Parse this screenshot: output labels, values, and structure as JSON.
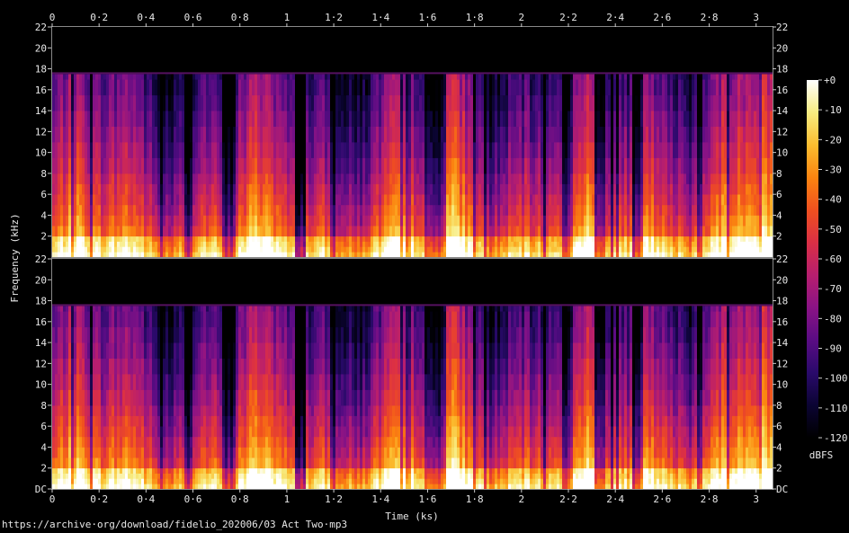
{
  "chart_data": {
    "type": "heatmap",
    "subtype": "spectrogram",
    "channels": 2,
    "xlabel": "Time (ks)",
    "ylabel": "Frequency (kHz)",
    "x_ticks": [
      "0",
      "0·2",
      "0·4",
      "0·6",
      "0·8",
      "1",
      "1·2",
      "1·4",
      "1·6",
      "1·8",
      "2",
      "2·2",
      "2·4",
      "2·6",
      "2·8",
      "3"
    ],
    "x_range": [
      0,
      3.07
    ],
    "y_ticks_top": [
      "22",
      "20",
      "18",
      "16",
      "14",
      "12",
      "10",
      "8",
      "6",
      "4",
      "2"
    ],
    "y_ticks_bottom": [
      "22",
      "20",
      "18",
      "16",
      "14",
      "12",
      "10",
      "8",
      "6",
      "4",
      "2",
      "DC"
    ],
    "y_range": [
      0,
      22
    ],
    "colorbar": {
      "label": "dBFS",
      "ticks": [
        "+0",
        "-10",
        "-20",
        "-30",
        "-40",
        "-50",
        "-60",
        "-70",
        "-80",
        "-90",
        "-100",
        "-110",
        "-120"
      ],
      "range": [
        -120,
        0
      ],
      "colors": [
        "#000000",
        "#0b0433",
        "#2a0a6b",
        "#5a0c84",
        "#8a1385",
        "#b71e6e",
        "#db2f45",
        "#f0501f",
        "#fb8410",
        "#fbbd2f",
        "#f7ec80",
        "#ffffff"
      ]
    },
    "cutoff_khz": 17.5,
    "dropouts_ks": [
      0.575,
      0.74,
      1.05,
      1.6,
      1.65,
      2.19,
      2.33,
      2.49
    ],
    "loud_segments_ks": [
      [
        1.65,
        1.85
      ],
      [
        2.5,
        2.7
      ],
      [
        2.85,
        3.07
      ]
    ],
    "grid": false
  },
  "source_url": "https://archive·org/download/fidelio_202006/03 Act Two·mp3"
}
